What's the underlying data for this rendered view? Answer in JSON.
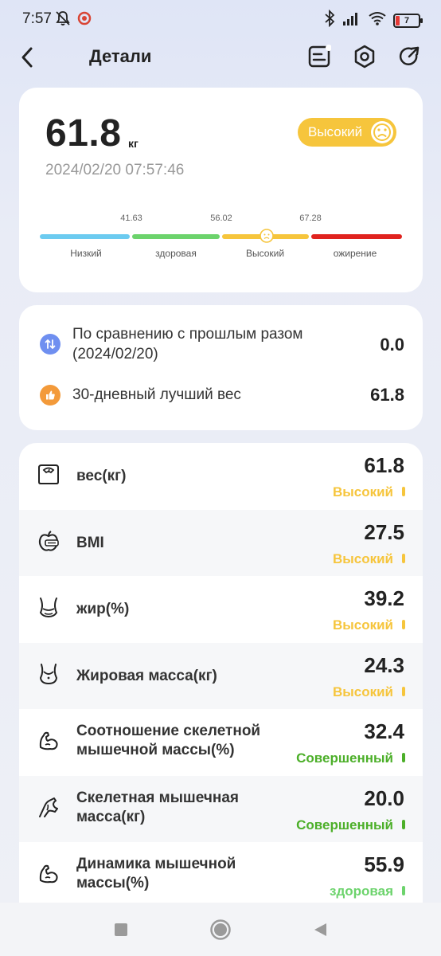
{
  "status_bar": {
    "time": "7:57",
    "battery_level": "7"
  },
  "header": {
    "title": "Детали"
  },
  "summary": {
    "weight": "61.8",
    "unit": "кг",
    "datetime": "2024/02/20 07:57:46",
    "status": "Высокий",
    "status_color": "#f6c53c",
    "scale": {
      "thresholds": [
        "41.63",
        "56.02",
        "67.28"
      ],
      "segments": [
        {
          "label": "Низкий",
          "color": "#6ccbf0"
        },
        {
          "label": "здоровая",
          "color": "#6cd36c"
        },
        {
          "label": "Высокий",
          "color": "#f6c53c"
        },
        {
          "label": "ожирение",
          "color": "#e0231f"
        }
      ]
    }
  },
  "compare": {
    "rows": [
      {
        "text_line1": "По сравнению с прошлым разом",
        "text_line2": "(2024/02/20)",
        "value": "0.0",
        "icon": "arrows-updown-icon",
        "icon_color": "#6f8ff0"
      },
      {
        "text_line1": "30-дневный лучший вес",
        "text_line2": "",
        "value": "61.8",
        "icon": "thumbs-up-icon",
        "icon_color": "#f39a3a"
      }
    ]
  },
  "metrics": [
    {
      "line1": "вес(кг)",
      "line2": "",
      "value": "61.8",
      "status": "Высокий",
      "color": "#f6c53c",
      "icon": "scale-icon"
    },
    {
      "line1": "BMI",
      "line2": "",
      "value": "27.5",
      "status": "Высокий",
      "color": "#f6c53c",
      "icon": "apple-icon"
    },
    {
      "line1": "жир(%)",
      "line2": "",
      "value": "39.2",
      "status": "Высокий",
      "color": "#f6c53c",
      "icon": "waist-icon"
    },
    {
      "line1": "Жировая масса(кг)",
      "line2": "",
      "value": "24.3",
      "status": "Высокий",
      "color": "#f6c53c",
      "icon": "belly-icon"
    },
    {
      "line1": "Соотношение скелетной",
      "line2": "мышечной массы(%)",
      "value": "32.4",
      "status": "Совершенный",
      "color": "#4caf29",
      "icon": "bicep-icon"
    },
    {
      "line1": "Скелетная мышечная",
      "line2": "масса(кг)",
      "value": "20.0",
      "status": "Совершенный",
      "color": "#4caf29",
      "icon": "arm-icon"
    },
    {
      "line1": "Динамика мышечной",
      "line2": "массы(%)",
      "value": "55.9",
      "status": "здоровая",
      "color": "#6cd36c",
      "icon": "bicep-icon"
    }
  ]
}
